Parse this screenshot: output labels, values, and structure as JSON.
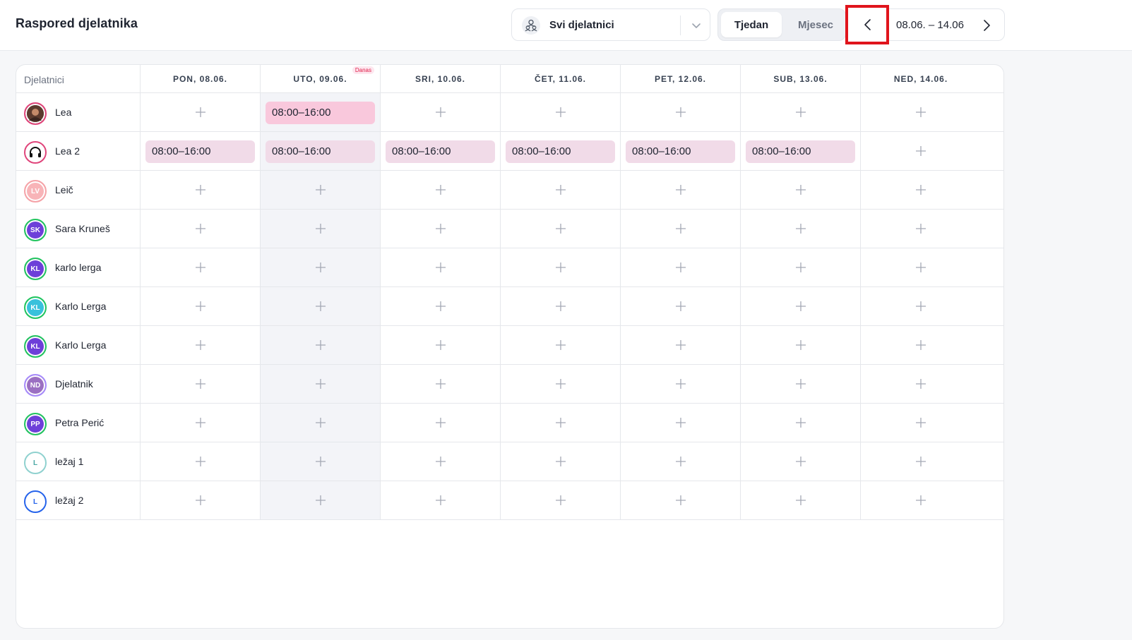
{
  "header": {
    "title": "Raspored djelatnika",
    "employee_filter": {
      "selected": "Svi djelatnici",
      "icon": "people-icon"
    },
    "view_toggle": {
      "week": "Tjedan",
      "month": "Mjesec",
      "active": "week"
    },
    "date_range": "08.06. – 14.06"
  },
  "table": {
    "name_header": "Djelatnici",
    "today_badge": "Danas",
    "today_index": 1,
    "days": [
      "PON, 08.06.",
      "UTO, 09.06.",
      "SRI, 10.06.",
      "ČET, 11.06.",
      "PET, 12.06.",
      "SUB, 13.06.",
      "NED, 14.06."
    ],
    "employees": [
      {
        "name": "Lea",
        "initials": "",
        "avatar": "photo",
        "ring": "#e0457b",
        "fill": "#7a4a3a",
        "shifts": [
          "",
          "08:00–16:00",
          "",
          "",
          "",
          "",
          ""
        ]
      },
      {
        "name": "Lea 2",
        "initials": "",
        "avatar": "headphones",
        "ring": "#e0457b",
        "fill": "#ffffff",
        "shifts": [
          "08:00–16:00",
          "08:00–16:00",
          "08:00–16:00",
          "08:00–16:00",
          "08:00–16:00",
          "08:00–16:00",
          ""
        ]
      },
      {
        "name": "Leič",
        "initials": "LV",
        "avatar": "initials",
        "ring": "#f5a3a8",
        "fill": "#f8b4b8",
        "shifts": [
          "",
          "",
          "",
          "",
          "",
          "",
          ""
        ]
      },
      {
        "name": "Sara Kruneš",
        "initials": "SK",
        "avatar": "initials",
        "ring": "#22c55e",
        "fill": "#6d3fd9",
        "shifts": [
          "",
          "",
          "",
          "",
          "",
          "",
          ""
        ]
      },
      {
        "name": "karlo lerga",
        "initials": "KL",
        "avatar": "initials",
        "ring": "#22c55e",
        "fill": "#6d3fd9",
        "shifts": [
          "",
          "",
          "",
          "",
          "",
          "",
          ""
        ]
      },
      {
        "name": "Karlo Lerga",
        "initials": "KL",
        "avatar": "initials",
        "ring": "#22c55e",
        "fill": "#38c1dc",
        "shifts": [
          "",
          "",
          "",
          "",
          "",
          "",
          ""
        ]
      },
      {
        "name": "Karlo Lerga",
        "initials": "KL",
        "avatar": "initials",
        "ring": "#22c55e",
        "fill": "#6d3fd9",
        "shifts": [
          "",
          "",
          "",
          "",
          "",
          "",
          ""
        ]
      },
      {
        "name": "Djelatnik",
        "initials": "ND",
        "avatar": "initials",
        "ring": "#a78bfa",
        "fill": "#9b6fc2",
        "shifts": [
          "",
          "",
          "",
          "",
          "",
          "",
          ""
        ]
      },
      {
        "name": "Petra Perić",
        "initials": "PP",
        "avatar": "initials",
        "ring": "#22c55e",
        "fill": "#6d3fd9",
        "shifts": [
          "",
          "",
          "",
          "",
          "",
          "",
          ""
        ]
      },
      {
        "name": "ležaj 1",
        "initials": "L",
        "avatar": "outline",
        "ring": "#8fd1cf",
        "fill": "#ffffff",
        "text": "#4aa7a3",
        "shifts": [
          "",
          "",
          "",
          "",
          "",
          "",
          ""
        ]
      },
      {
        "name": "ležaj 2",
        "initials": "L",
        "avatar": "outline",
        "ring": "#2563eb",
        "fill": "#ffffff",
        "text": "#2563eb",
        "shifts": [
          "",
          "",
          "",
          "",
          "",
          "",
          ""
        ]
      }
    ]
  },
  "icons": {
    "add": "plus-icon",
    "prev": "chevron-left-icon",
    "next": "chevron-right-icon",
    "dropdown": "chevron-down-icon"
  }
}
